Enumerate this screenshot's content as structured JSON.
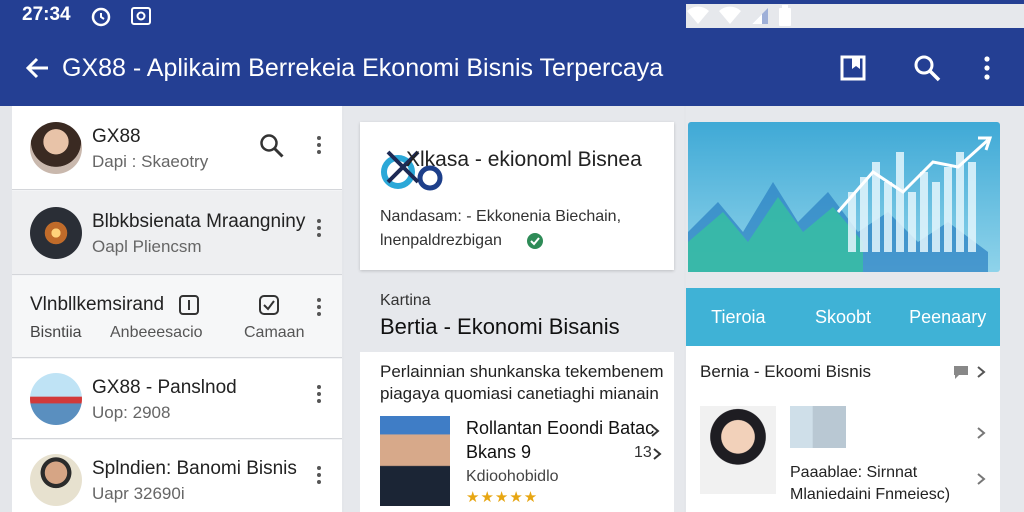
{
  "status_bar": {
    "time": "27:34"
  },
  "app_bar": {
    "title": "GX88 - Aplikaim Berrekeia Ekonomi Bisnis Terpercaya"
  },
  "left_list": {
    "items": [
      {
        "title": "GX88",
        "subtitle": "Dapi : Skaeotry"
      },
      {
        "title": "Blbkbsienata Mraangniny",
        "subtitle": "Oapl Pliencsm"
      },
      {
        "title": "GX88 - Panslnod",
        "subtitle": "Uop: 2908"
      },
      {
        "title": "Splndien: Banomi Bisnis",
        "subtitle": "Uapr 32690i"
      }
    ],
    "toolbar_row": {
      "title": "Vlnbllkemsirand",
      "tabs": [
        "Bisntiia",
        "Anbeeesacio",
        "Camaan"
      ]
    }
  },
  "center": {
    "logo_card": {
      "logo_text": "Xlkasa - ekionoml Bisnea",
      "line1": "Nandasam: - Ekkonenia Biechain,",
      "line2": "lnenpaldrezbigan"
    },
    "article_card": {
      "eyebrow": "Kartina",
      "heading": "Bertia - Ekonomi Bisanis",
      "para1": "Perlainnian shunkanska tekembenem",
      "para2": "piagaya quomiasi canetiaghi mianain",
      "item_title1": "Rollantan Eoondi Batac",
      "item_title2": "Bkans 9",
      "item_meta": "Kdioohobidlo",
      "item_count": "13",
      "stars": "★★★★★"
    }
  },
  "right": {
    "tabs": [
      "Tieroia",
      "Skoobt",
      "Peenaary"
    ],
    "news_title": "Bernia - Ekoomi Bisnis",
    "caption1": "Paaablae: Sirnnat",
    "caption2": "Mlaniedaini Fnmeiesc)"
  },
  "colors": {
    "primary": "#243f93",
    "accent": "#3fb2d6",
    "chart_bg": "#55b6d6"
  }
}
